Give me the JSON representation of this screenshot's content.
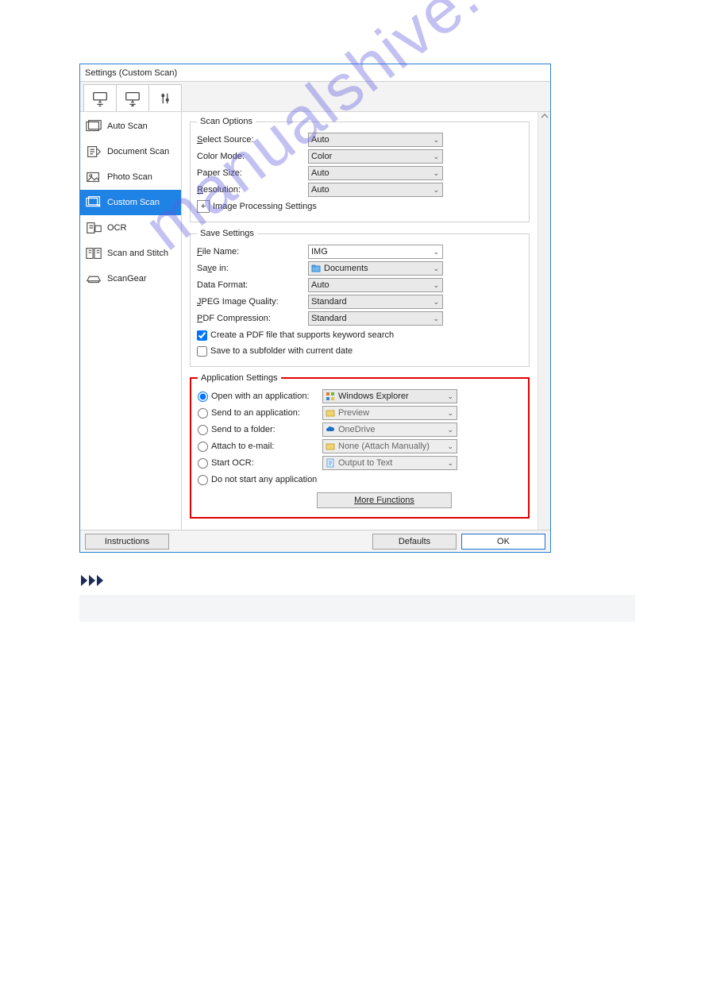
{
  "window": {
    "title": "Settings (Custom Scan)"
  },
  "sidebar": {
    "items": [
      {
        "label": "Auto Scan"
      },
      {
        "label": "Document Scan"
      },
      {
        "label": "Photo Scan"
      },
      {
        "label": "Custom Scan"
      },
      {
        "label": "OCR"
      },
      {
        "label": "Scan and Stitch"
      },
      {
        "label": "ScanGear"
      }
    ],
    "active_index": 3
  },
  "scan_options": {
    "legend": "Scan Options",
    "select_source": {
      "label": "Select Source:",
      "value": "Auto"
    },
    "color_mode": {
      "label": "Color Mode:",
      "value": "Color"
    },
    "paper_size": {
      "label": "Paper Size:",
      "value": "Auto"
    },
    "resolution": {
      "label": "Resolution:",
      "value": "Auto"
    },
    "image_processing": {
      "label": "Image Processing Settings"
    }
  },
  "save_settings": {
    "legend": "Save Settings",
    "file_name": {
      "label": "File Name:",
      "value": "IMG"
    },
    "save_in": {
      "label": "Save in:",
      "value": "Documents"
    },
    "data_format": {
      "label": "Data Format:",
      "value": "Auto"
    },
    "jpeg_quality": {
      "label": "JPEG Image Quality:",
      "value": "Standard"
    },
    "pdf_compression": {
      "label": "PDF Compression:",
      "value": "Standard"
    },
    "pdf_keyword": {
      "label": "Create a PDF file that supports keyword search",
      "checked": true
    },
    "subfolder_date": {
      "label": "Save to a subfolder with current date",
      "checked": false
    }
  },
  "app_settings": {
    "legend": "Application Settings",
    "selected": "open_with",
    "open_with": {
      "label": "Open with an application:",
      "value": "Windows Explorer"
    },
    "send_app": {
      "label": "Send to an application:",
      "value": "Preview"
    },
    "send_folder": {
      "label": "Send to a folder:",
      "value": "OneDrive"
    },
    "attach_email": {
      "label": "Attach to e-mail:",
      "value": "None (Attach Manually)"
    },
    "start_ocr": {
      "label": "Start OCR:",
      "value": "Output to Text"
    },
    "none": {
      "label": "Do not start any application"
    },
    "more_functions": "More Functions"
  },
  "footer": {
    "instructions": "Instructions",
    "defaults": "Defaults",
    "ok": "OK"
  },
  "watermark": "manualshive.com"
}
